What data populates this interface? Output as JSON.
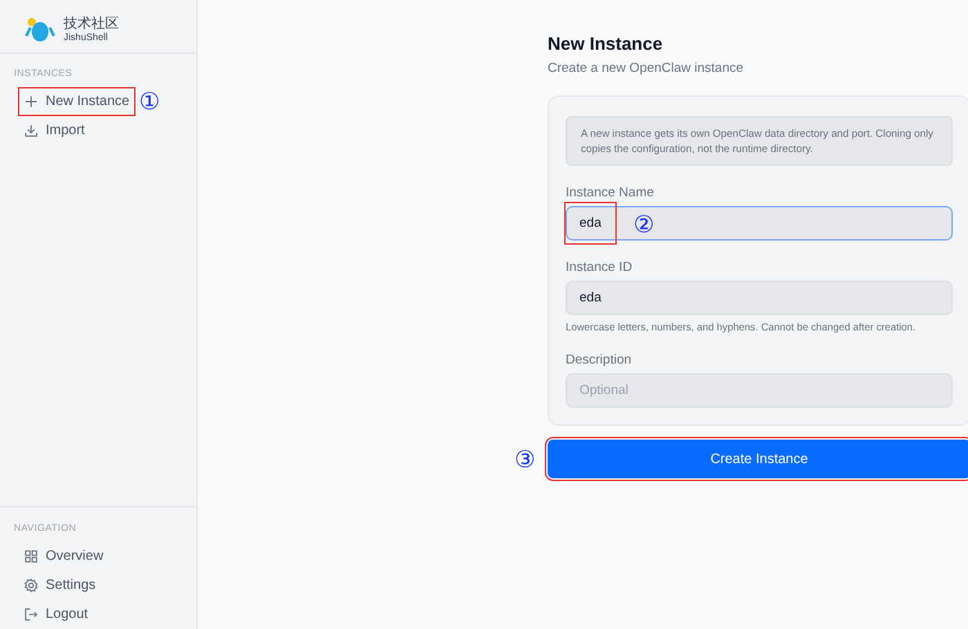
{
  "sidebar": {
    "logo": {
      "line_1": "技术社区",
      "line_2": "JishuShell"
    },
    "sections": [
      {
        "heading": "INSTANCES",
        "items": [
          {
            "label": "New Instance",
            "annotation": "①"
          },
          {
            "label": "Import"
          }
        ]
      },
      {
        "heading": "NAVIGATION",
        "items": [
          {
            "label": "Overview"
          },
          {
            "label": "Settings"
          },
          {
            "label": "Logout"
          }
        ]
      }
    ]
  },
  "page": {
    "title": "New Instance",
    "subtitle": "Create a new OpenClaw instance",
    "notice": "A new instance gets its own OpenClaw data directory and port. Cloning only copies the configuration, not the runtime directory.",
    "fields": [
      {
        "label": "Instance Name",
        "value": "eda",
        "focused": true,
        "annotation": "②"
      },
      {
        "label": "Instance ID",
        "value": "eda",
        "focused": false,
        "hint": "Lowercase letters, numbers, and hyphens. Cannot be changed after creation."
      },
      {
        "label": "Description",
        "placeholder": "Optional",
        "focused": false
      }
    ],
    "submit": {
      "label": "Create Instance",
      "annotation": "③"
    }
  }
}
